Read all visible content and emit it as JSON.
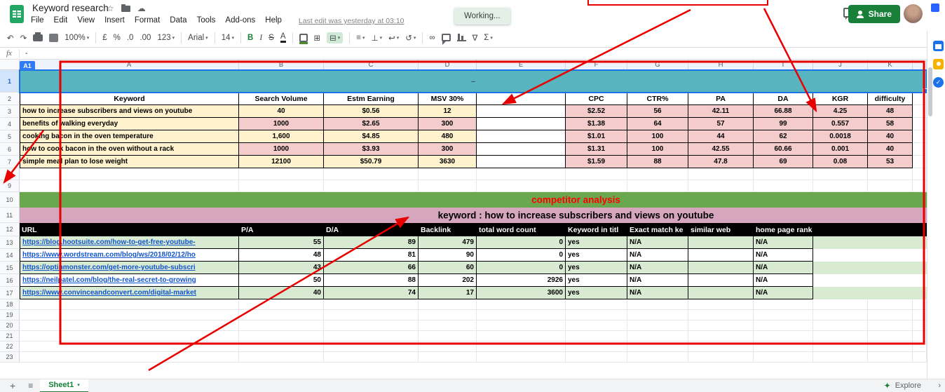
{
  "titlebar": {
    "title": "Keyword research",
    "menus": [
      "File",
      "Edit",
      "View",
      "Insert",
      "Format",
      "Data",
      "Tools",
      "Add-ons",
      "Help"
    ],
    "last_edit": "Last edit was yesterday at 03:10",
    "toast": "Working...",
    "share_label": "Share"
  },
  "toolbar": {
    "zoom": "100%",
    "currency": "£",
    "percent": "%",
    "decimal_decrease": ".0",
    "decimal_increase": ".00",
    "more_formats": "123",
    "font": "Arial",
    "font_size": "14",
    "bold": "B",
    "italic": "I",
    "strikethrough": "S",
    "text_color": "A",
    "functions": "Σ"
  },
  "formula_bar": {
    "name_box": "A1",
    "fx_label": "fx",
    "value": "-"
  },
  "grid": {
    "columns": [
      "A",
      "B",
      "C",
      "D",
      "E",
      "F",
      "G",
      "H",
      "I",
      "J",
      "K"
    ],
    "row_count": 23,
    "selected_cell": "A1",
    "merged_cell_value": "–"
  },
  "table1": {
    "headers": [
      "Keyword",
      "Search Volume",
      "Estm Earning",
      "MSV 30%",
      "",
      "CPC",
      "CTR%",
      "PA",
      "DA",
      "KGR",
      "difficulty"
    ],
    "rows": [
      [
        "how to increase subscribers and views on youtube",
        "40",
        "$0.56",
        "12",
        "",
        "$2.52",
        "56",
        "42.11",
        "66.88",
        "4.25",
        "48"
      ],
      [
        "benefits of walking everyday",
        "1000",
        "$2.65",
        "300",
        "",
        "$1.38",
        "64",
        "57",
        "99",
        "0.557",
        "58"
      ],
      [
        "cooking bacon in the oven temperature",
        "1,600",
        "$4.85",
        "480",
        "",
        "$1.01",
        "100",
        "44",
        "62",
        "0.0018",
        "40"
      ],
      [
        "how to cook bacon in the oven without a rack",
        "1000",
        "$3.93",
        "300",
        "",
        "$1.31",
        "100",
        "42.55",
        "60.66",
        "0.001",
        "40"
      ],
      [
        "simple meal plan to lose weight",
        "12100",
        "$50.79",
        "3630",
        "",
        "$1.59",
        "88",
        "47.8",
        "69",
        "0.08",
        "53"
      ]
    ]
  },
  "bands": {
    "competitor_title": "competitor analysis",
    "keyword_line": "keyword  : how to increase subscribers and views on youtube"
  },
  "table2": {
    "headers": [
      "URL",
      "P/A",
      "D/A",
      "Backlink",
      "total word count",
      "Keyword in titl",
      "Exact match ke",
      "similar web",
      "home page rank"
    ],
    "rows": [
      [
        "https://blog.hootsuite.com/how-to-get-free-youtube-",
        "55",
        "89",
        "479",
        "0",
        "yes",
        "N/A",
        "",
        "N/A"
      ],
      [
        "https://www.wordstream.com/blog/ws/2018/02/12/ho",
        "48",
        "81",
        "90",
        "0",
        "yes",
        "N/A",
        "",
        "N/A"
      ],
      [
        "https://optinmonster.com/get-more-youtube-subscri",
        "43",
        "66",
        "60",
        "0",
        "yes",
        "N/A",
        "",
        "N/A"
      ],
      [
        "https://neilpatel.com/blog/the-real-secret-to-growing",
        "50",
        "88",
        "202",
        "2926",
        "yes",
        "N/A",
        "",
        "N/A"
      ],
      [
        "https://www.convinceandconvert.com/digital-market",
        "40",
        "74",
        "17",
        "3600",
        "yes",
        "N/A",
        "",
        "N/A"
      ]
    ]
  },
  "sheetbar": {
    "active_tab": "Sheet1",
    "explore_label": "Explore"
  },
  "colors": {
    "selection_band_teal": "#58b5c0",
    "band_green": "#6aa84f",
    "band_pink": "#d5a6bd",
    "row_cream": "#fff2cc",
    "row_rose": "#f4cccc",
    "row_green": "#d9ead3",
    "link_blue": "#1155cc",
    "annotation_red": "#e80000",
    "competitor_text_red": "#ff0000",
    "share_green": "#188038"
  }
}
